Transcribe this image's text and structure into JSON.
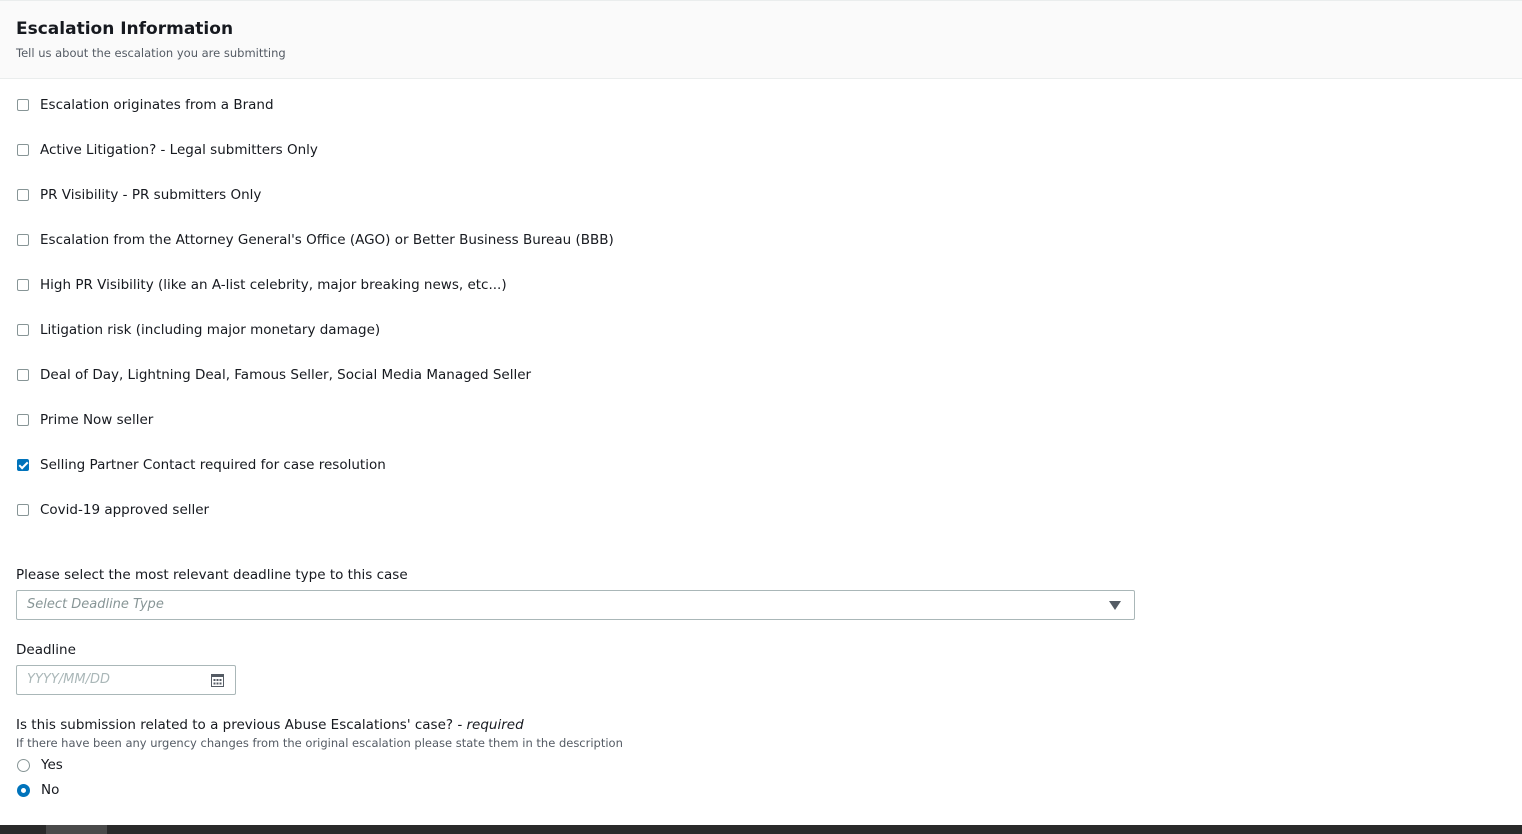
{
  "header": {
    "title": "Escalation Information",
    "subtitle": "Tell us about the escalation you are submitting"
  },
  "checkboxes": [
    {
      "label": "Escalation originates from a Brand",
      "checked": false
    },
    {
      "label": "Active Litigation? - Legal submitters Only",
      "checked": false
    },
    {
      "label": "PR Visibility - PR submitters Only",
      "checked": false
    },
    {
      "label": "Escalation from the Attorney General's Office (AGO) or Better Business Bureau (BBB)",
      "checked": false
    },
    {
      "label": "High PR Visibility (like an A-list celebrity, major breaking news, etc...)",
      "checked": false
    },
    {
      "label": "Litigation risk (including major monetary damage)",
      "checked": false
    },
    {
      "label": "Deal of Day, Lightning Deal, Famous Seller, Social Media Managed Seller",
      "checked": false
    },
    {
      "label": "Prime Now seller",
      "checked": false
    },
    {
      "label": "Selling Partner Contact required for case resolution",
      "checked": true
    },
    {
      "label": "Covid-19 approved seller",
      "checked": false
    }
  ],
  "deadline_type": {
    "label": "Please select the most relevant deadline type to this case",
    "placeholder": "Select Deadline Type",
    "icon": "caret-down-icon"
  },
  "deadline": {
    "label": "Deadline",
    "placeholder": "YYYY/MM/DD",
    "icon": "calendar-icon"
  },
  "previous_case": {
    "label": "Is this submission related to a previous Abuse Escalations' case?",
    "required_text": "- required",
    "hint": "If there have been any urgency changes from the original escalation please state them in the description",
    "options": [
      {
        "label": "Yes",
        "selected": false
      },
      {
        "label": "No",
        "selected": true
      }
    ]
  },
  "colors": {
    "accent": "#0073bb",
    "text": "#16191f",
    "secondary_text": "#545b64",
    "border": "#aab7b8",
    "header_bg": "#fafafa"
  }
}
